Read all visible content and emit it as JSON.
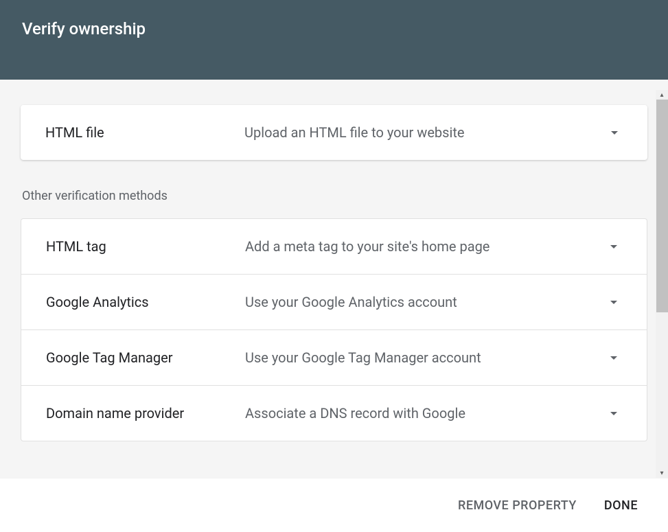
{
  "header": {
    "title": "Verify ownership"
  },
  "primary": {
    "title": "HTML file",
    "desc": "Upload an HTML file to your website",
    "icon": "expand-more-icon"
  },
  "other_label": "Other verification methods",
  "methods": [
    {
      "title": "HTML tag",
      "desc": "Add a meta tag to your site's home page",
      "icon": "expand-more-icon"
    },
    {
      "title": "Google Analytics",
      "desc": "Use your Google Analytics account",
      "icon": "expand-more-icon"
    },
    {
      "title": "Google Tag Manager",
      "desc": "Use your Google Tag Manager account",
      "icon": "expand-more-icon"
    },
    {
      "title": "Domain name provider",
      "desc": "Associate a DNS record with Google",
      "icon": "expand-more-icon"
    }
  ],
  "footer": {
    "remove": "REMOVE PROPERTY",
    "done": "DONE"
  }
}
